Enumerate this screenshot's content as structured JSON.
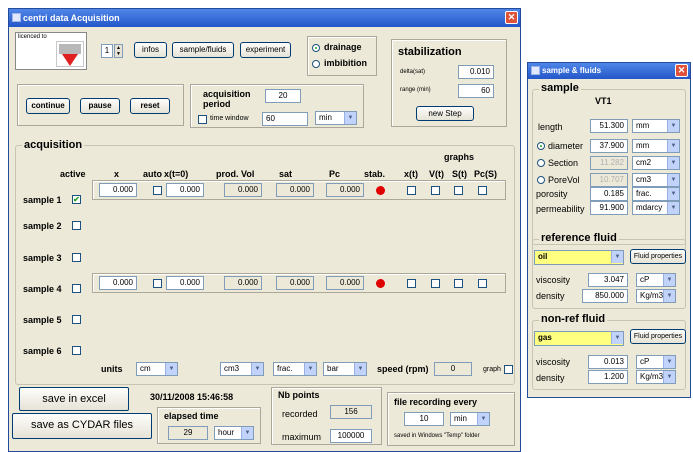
{
  "main": {
    "title": "centri data Acquisition",
    "close": "✕",
    "licensed_label": "licenced to",
    "spinner_value": "1",
    "buttons": {
      "infos": "infos",
      "sample_fluids": "sample/fluids",
      "experiment": "experiment",
      "continue": "continue",
      "pause": "pause",
      "reset": "reset",
      "new_step": "new Step",
      "save_excel": "save in excel",
      "save_cydar": "save as CYDAR files"
    },
    "mode": {
      "drainage": "drainage",
      "imbibition": "imbibition",
      "selected": "drainage"
    },
    "stabilization": {
      "title": "stabilization",
      "delta_label": "delta(sat)",
      "delta_value": "0.010",
      "range_label": "range (min)",
      "range_value": "60"
    },
    "acq_period": {
      "title_line1": "acquisition",
      "title_line2": "period",
      "value": "20",
      "time_window_label": "time window",
      "time_window_value": "60",
      "unit": "min"
    },
    "acquisition": {
      "title": "acquisition",
      "headers": {
        "active": "active",
        "x": "x",
        "auto": "auto",
        "x0": "x(t=0)",
        "prod": "prod. Vol",
        "sat": "sat",
        "pc": "Pc",
        "stab": "stab.",
        "graphs": "graphs",
        "xt": "x(t)",
        "vt": "V(t)",
        "st": "S(t)",
        "pcs": "Pc(S)"
      },
      "samples": [
        {
          "label": "sample 1",
          "active": "✔",
          "x": "0.000",
          "x0": "0.000",
          "prod": "0.000",
          "sat": "0.000",
          "pc": "0.000"
        },
        {
          "label": "sample 2"
        },
        {
          "label": "sample 3"
        },
        {
          "label": "sample 4",
          "x": "0.000",
          "x0": "0.000",
          "prod": "0.000",
          "sat": "0.000",
          "pc": "0.000"
        },
        {
          "label": "sample 5"
        },
        {
          "label": "sample 6"
        }
      ],
      "units_label": "units",
      "units": {
        "x": "cm",
        "vol": "cm3",
        "sat": "frac.",
        "pc": "bar"
      },
      "speed_label": "speed (rpm)",
      "speed_value": "0",
      "graph_label": "graph"
    },
    "timestamp": "30/11/2008 15:46:58",
    "elapsed": {
      "title": "elapsed time",
      "value": "29",
      "unit": "hour"
    },
    "nb_points": {
      "title": "Nb points",
      "recorded_label": "recorded",
      "recorded_value": "156",
      "maximum_label": "maximum",
      "maximum_value": "100000"
    },
    "file_recording": {
      "title": "file recording every",
      "value": "10",
      "unit": "min",
      "note": "saved in Windows \"Temp\" folder"
    }
  },
  "sample_window": {
    "title": "sample & fluids",
    "close": "✕",
    "sample": {
      "title": "sample",
      "name": "VT1",
      "length_label": "length",
      "length_value": "51.300",
      "length_unit": "mm",
      "diameter_label": "diameter",
      "diameter_value": "37.900",
      "diameter_unit": "mm",
      "section_label": "Section",
      "section_value": "11.282",
      "section_unit": "cm2",
      "porevol_label": "PoreVol",
      "porevol_value": "10.707",
      "porevol_unit": "cm3",
      "porosity_label": "porosity",
      "porosity_value": "0.185",
      "porosity_unit": "frac.",
      "permeability_label": "permeability",
      "permeability_value": "91.900",
      "permeability_unit": "mdarcy"
    },
    "reference_fluid": {
      "title": "reference fluid",
      "fluid": "oil",
      "props_button": "Fluid properties",
      "viscosity_label": "viscosity",
      "viscosity_value": "3.047",
      "viscosity_unit": "cP",
      "density_label": "density",
      "density_value": "850.000",
      "density_unit": "Kg/m3"
    },
    "nonref_fluid": {
      "title": "non-ref fluid",
      "fluid": "gas",
      "props_button": "Fluid properties",
      "viscosity_label": "viscosity",
      "viscosity_value": "0.013",
      "viscosity_unit": "cP",
      "density_label": "density",
      "density_value": "1.200",
      "density_unit": "Kg/m3"
    }
  },
  "colors": {
    "accent": "#2456c8",
    "status_red": "#e00000",
    "highlight_yellow": "#ffff80"
  }
}
